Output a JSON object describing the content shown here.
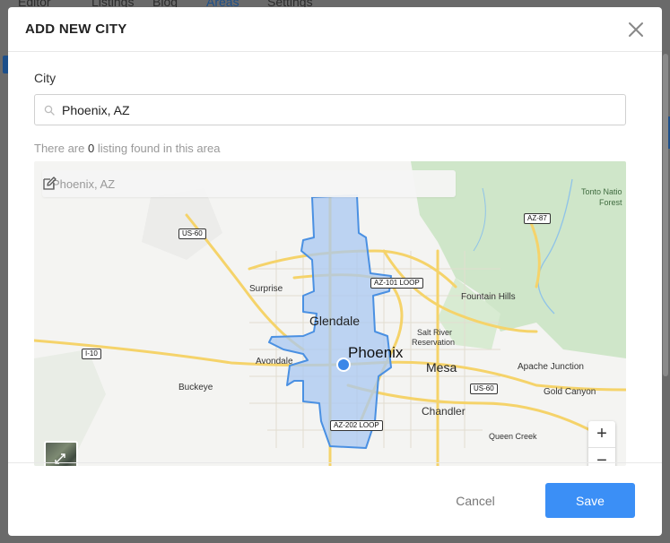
{
  "background": {
    "nav_items": [
      "Editor",
      "Listings",
      "Blog",
      "Areas",
      "Settings"
    ],
    "active_nav": "Areas"
  },
  "modal": {
    "title": "ADD NEW CITY",
    "close_icon": "close-icon"
  },
  "form": {
    "city_label": "City",
    "city_value": "Phoenix, AZ",
    "search_icon": "search-icon"
  },
  "listing_info": {
    "prefix": "There are",
    "count": "0",
    "suffix": "listing found in this area"
  },
  "map": {
    "search_text": "Phoenix, AZ",
    "edit_icon": "edit-icon",
    "zoom_in": "+",
    "zoom_out": "−",
    "labels": {
      "phoenix": "Phoenix",
      "glendale": "Glendale",
      "mesa": "Mesa",
      "chandler": "Chandler",
      "surprise": "Surprise",
      "avondale": "Avondale",
      "buckeye": "Buckeye",
      "fountain_hills": "Fountain Hills",
      "salt_river_1": "Salt River",
      "salt_river_2": "Reservation",
      "apache_junction": "Apache Junction",
      "gold_canyon": "Gold Canyon",
      "queen_creek": "Queen Creek",
      "tonto_1": "Tonto Natio",
      "tonto_2": "Forest"
    },
    "shields": {
      "us60_w": "US-60",
      "i10": "I-10",
      "az87": "AZ-87",
      "az101": "AZ-101 LOOP",
      "us60_e": "US-60",
      "az202": "AZ-202 LOOP"
    },
    "colors": {
      "boundary": "#4a90e2",
      "boundary_fill": "#a9c8f2",
      "highway": "#f5d36a",
      "park": "#cfe6c9"
    }
  },
  "footer": {
    "cancel_label": "Cancel",
    "save_label": "Save"
  }
}
